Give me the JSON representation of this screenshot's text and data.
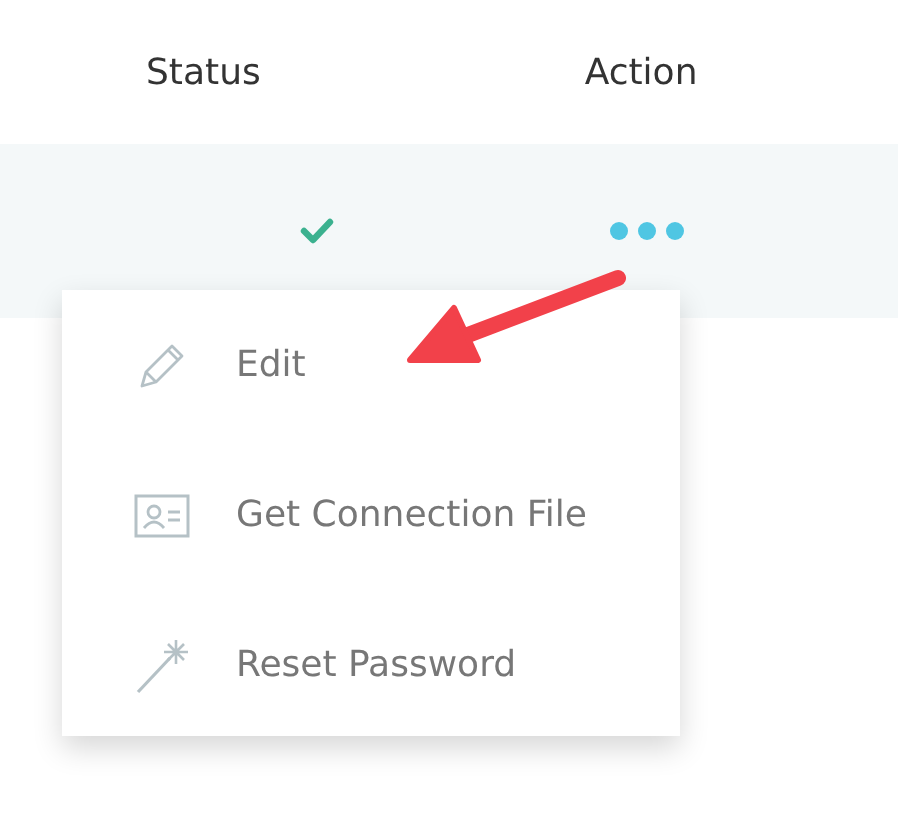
{
  "table": {
    "columns": [
      "Status",
      "Action"
    ],
    "rows": [
      {
        "kind": "check"
      }
    ]
  },
  "menu": {
    "items": [
      {
        "kind": "edit",
        "label": "Edit"
      },
      {
        "kind": "contact",
        "label": "Get Connection File"
      },
      {
        "kind": "wand",
        "label": "Reset Password"
      }
    ]
  }
}
